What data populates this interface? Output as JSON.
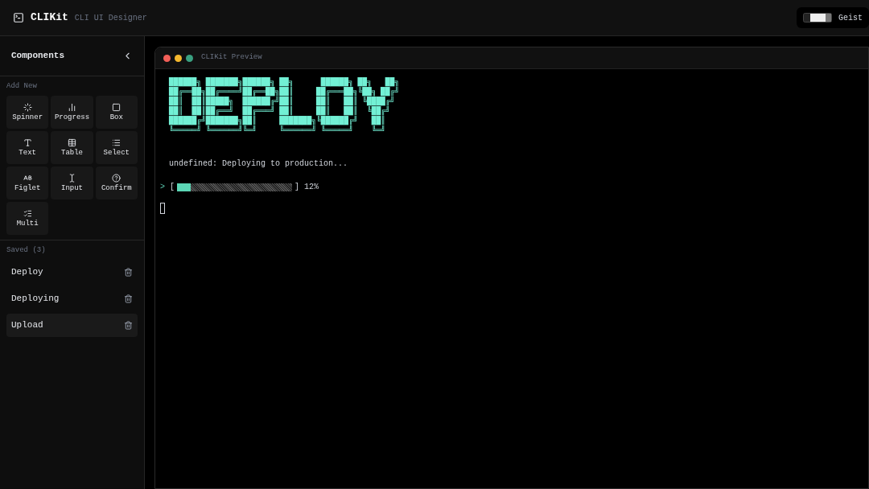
{
  "header": {
    "app_name": "CLIKit",
    "subtitle": "CLI UI Designer",
    "font_label": "Geist"
  },
  "sidebar": {
    "title": "Components",
    "add_heading": "Add New",
    "components": [
      {
        "label": "Spinner",
        "kind": "spinner"
      },
      {
        "label": "Progress",
        "kind": "progress"
      },
      {
        "label": "Box",
        "kind": "box"
      },
      {
        "label": "Text",
        "kind": "text"
      },
      {
        "label": "Table",
        "kind": "table"
      },
      {
        "label": "Select",
        "kind": "select"
      },
      {
        "label": "Figlet",
        "kind": "figlet"
      },
      {
        "label": "Input",
        "kind": "input"
      },
      {
        "label": "Confirm",
        "kind": "confirm"
      },
      {
        "label": "Multi",
        "kind": "multi"
      }
    ],
    "saved_heading": "Saved (3)",
    "saved": [
      {
        "label": "Deploy",
        "selected": false
      },
      {
        "label": "Deploying",
        "selected": false
      },
      {
        "label": "Upload",
        "selected": true
      }
    ]
  },
  "preview": {
    "title": "CLIKit Preview",
    "figlet": [
      "██████╗ ███████╗██████╗ ██╗      ██████╗ ██╗   ██╗",
      "██╔══██╗██╔════╝██╔══██╗██║     ██╔═══██╗╚██╗ ██╔╝",
      "██║  ██║█████╗  ██████╔╝██║     ██║   ██║ ╚████╔╝ ",
      "██║  ██║██╔══╝  ██╔═══╝ ██║     ██║   ██║  ╚██╔╝  ",
      "██████╔╝███████╗██║     ███████╗╚██████╔╝   ██║   ",
      "╚═════╝ ╚══════╝╚═╝     ╚══════╝ ╚═════╝    ╚═╝   "
    ],
    "status_line": "undefined: Deploying to production...",
    "progress": {
      "prompt": ">",
      "open": "[",
      "close": "]",
      "level": 0.12,
      "reading": "12%"
    }
  }
}
